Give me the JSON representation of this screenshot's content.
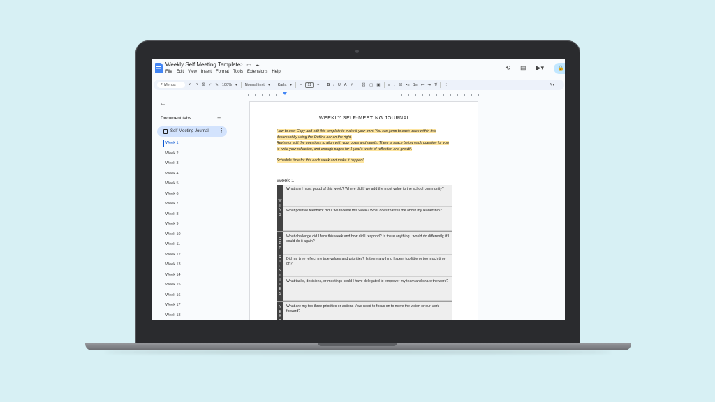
{
  "app": {
    "doc_title": "Weekly Self Meeting Template",
    "menu": [
      "File",
      "Edit",
      "View",
      "Insert",
      "Format",
      "Tools",
      "Extensions",
      "Help"
    ]
  },
  "toolbar": {
    "menus_label": "Menus",
    "zoom": "100%",
    "style": "Normal text",
    "font": "Karla",
    "font_size": "11"
  },
  "sidebar": {
    "title": "Document tabs",
    "active_tab": "Self Meeting Journal",
    "outline": [
      "Week 1",
      "Week 2",
      "Week 3",
      "Week 4",
      "Week 5",
      "Week 6",
      "Week 7",
      "Week 8",
      "Week 9",
      "Week 10",
      "Week 11",
      "Week 12",
      "Week 13",
      "Week 14",
      "Week 15",
      "Week 16",
      "Week 17",
      "Week 18"
    ]
  },
  "document": {
    "title": "WEEKLY SELF-MEETING JOURNAL",
    "intro_1": "How to use: Copy and edit this template to make it your own! You can jump to each week within this document by using the Outline bar on the right.",
    "intro_2": "Revise or edit the questions to align with your goals and needs. There is space below each question for you to write your reflection, and enough pages for 1 year's worth of reflection and growth.",
    "intro_3": "Schedule time for this each week and make it happen!",
    "week_heading": "Week 1",
    "sections": [
      {
        "label": "WINS",
        "questions": [
          "What am I most proud of this week? Where did I/ we add the most value to the school community?",
          "What positive feedback did I/ we receive this week? What does that tell me about my leadership?"
        ]
      },
      {
        "label": "OPPORTUNITIES",
        "questions": [
          "What challenge did I face this week and how did I respond? Is there anything I would do differently, if I could do it again?",
          "Did my time reflect my true values and priorities? Is there anything I spent too little or too much time on?",
          "What tasks, decisions, or meetings could I have delegated to empower my team and share the work?"
        ]
      },
      {
        "label": "NEXT",
        "questions": [
          "What are my top three priorities or actions I/ we need to focus on to move the vision or our work forward?"
        ]
      }
    ]
  },
  "colors": {
    "background": "#d7f0f4",
    "highlight": "#fde49e",
    "accent": "#0b57d0",
    "section_label_bg": "#424242"
  }
}
